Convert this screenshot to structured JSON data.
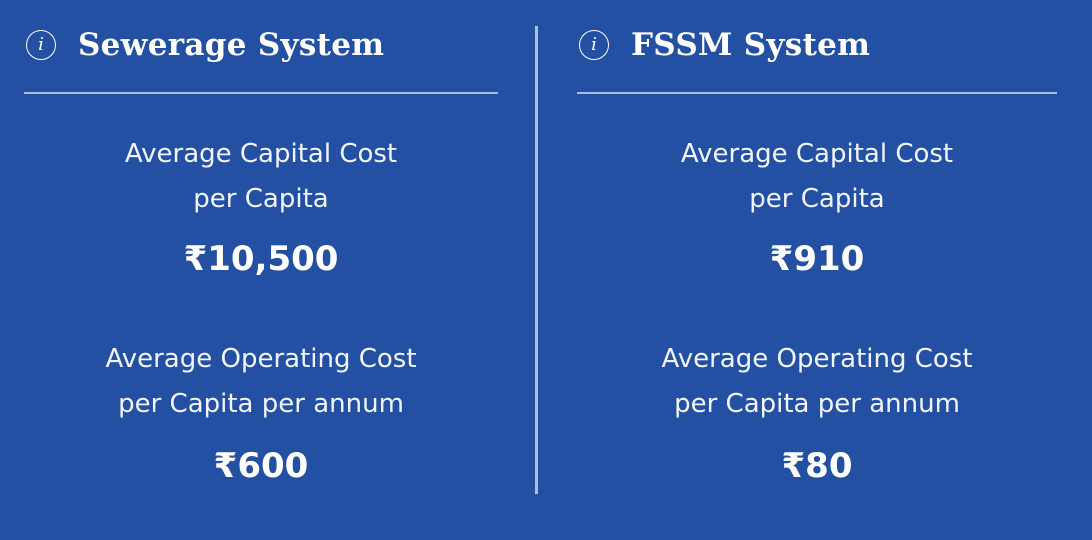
{
  "sewerage": {
    "title": "Sewerage System",
    "info_glyph": "i",
    "capital_label_line1": "Average Capital Cost",
    "capital_label_line2": "per Capita",
    "capital_value": "₹10,500",
    "operating_label_line1": "Average Operating Cost",
    "operating_label_line2": "per Capita per annum",
    "operating_value": "₹600"
  },
  "fssm": {
    "title": "FSSM System",
    "info_glyph": "i",
    "capital_label_line1": "Average Capital Cost",
    "capital_label_line2": "per Capita",
    "capital_value": "₹910",
    "operating_label_line1": "Average Operating Cost",
    "operating_label_line2": "per Capita per annum",
    "operating_value": "₹80"
  },
  "icons": {
    "info": "info-icon"
  },
  "colors": {
    "background": "#2350a3",
    "text": "#ffffff",
    "divider": "#aebee0"
  }
}
